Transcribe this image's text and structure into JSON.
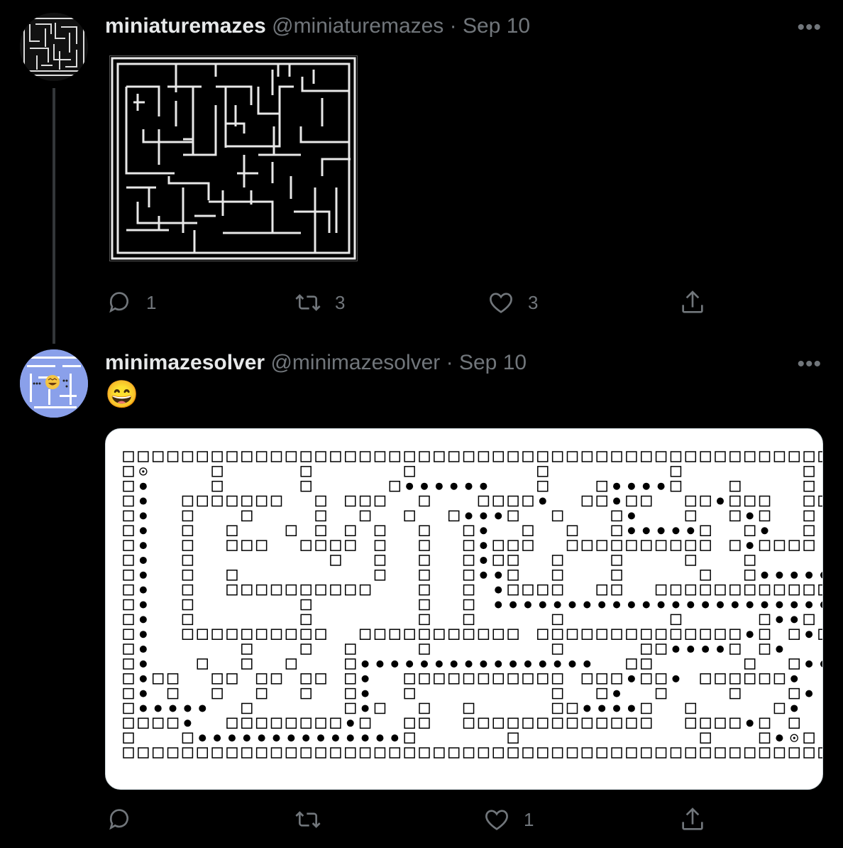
{
  "tweet1": {
    "display_name": "miniaturemazes",
    "handle": "@miniaturemazes",
    "date": "Sep 10",
    "separator": "·",
    "more": "•••",
    "replies": "1",
    "retweets": "3",
    "likes": "3"
  },
  "tweet2": {
    "display_name": "minimazesolver",
    "handle": "@minimazesolver",
    "date": "Sep 10",
    "separator": "·",
    "more": "•••",
    "text": "😄",
    "replies": "",
    "retweets": "",
    "likes": "1"
  },
  "maze_grid": [
    "###################################################",
    "#o    #     #      #        #        #        #   #",
    "#*    #     #     #******   #   #****#   #    #   #",
    "#*  #######  # ###  #   ####*  ##*##  ##*###  #####",
    "#*  #   #    #  #  #  #***#  #   #*   #  #*#  #   #",
    "#*  #  #   # # # #  #  #*  #  #  #*****#  #*  #   #",
    "#*  #  ###  #### #  #  #*###  ########## #*#### #",
    "#*  #         #  #  #  #*##  #   #    #   #     # ",
    "#*  #  #         #  #  #**#  #   #     #  #****** #",
    "#*  #  ##########   #  # *####  ##  ############*#",
    "#*  #       #       #  # ***********************##",
    "#*  #       #       #  #     #       #     #**#  #",
    "#*  ##########  ########### ##############*# #*####",
    "#*      #   #  #    #        #     ##****# #*   #",
    "#*   #  #  #   #****************  ##      #  #** #",
    "#*##  ## ## ## #*  ########### ###*##* ######*  #",
    "#* #  #  #  #  #*  #         #  #*  #    #   #*  #",
    "#*****  #      #*#  #  #     ##****#  #     #*  #",
    "####*  ########*#  ##  #############  ####*# #",
    "#   #**************#      #            #   #*o#",
    "###################################################"
  ]
}
